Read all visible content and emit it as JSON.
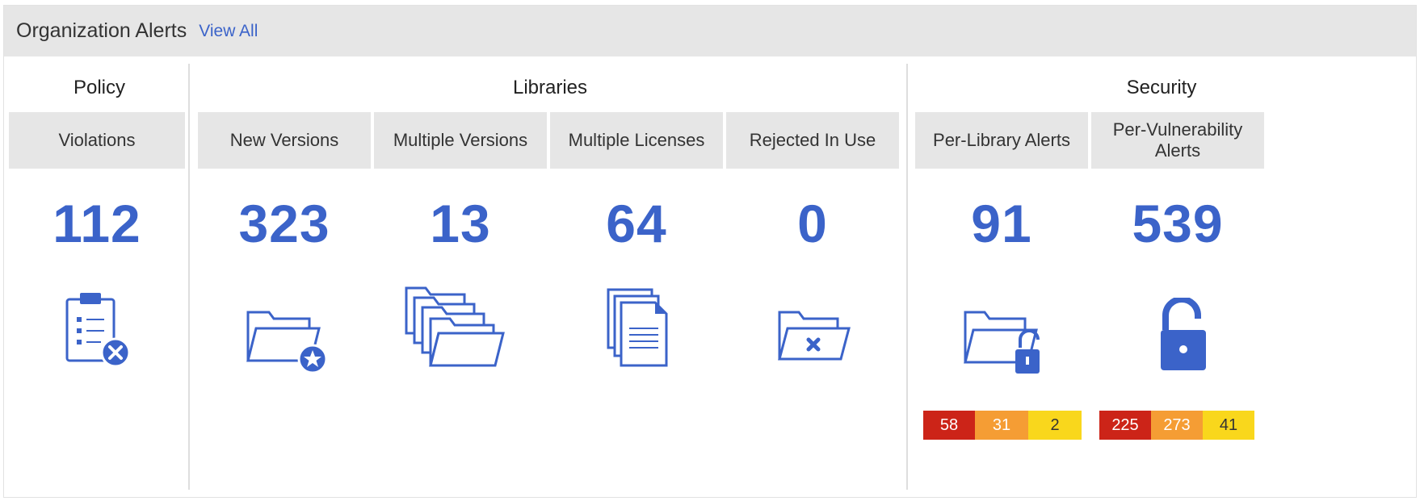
{
  "header": {
    "title": "Organization Alerts",
    "view_all": "View All"
  },
  "groups": {
    "policy": "Policy",
    "libraries": "Libraries",
    "security": "Security"
  },
  "columns": {
    "violations": {
      "label": "Violations",
      "count": "112",
      "icon": "clipboard-x-icon"
    },
    "new_versions": {
      "label": "New Versions",
      "count": "323",
      "icon": "folder-star-icon"
    },
    "multiple_versions": {
      "label": "Multiple Versions",
      "count": "13",
      "icon": "stacked-folders-icon"
    },
    "multiple_licenses": {
      "label": "Multiple Licenses",
      "count": "64",
      "icon": "stacked-documents-icon"
    },
    "rejected_in_use": {
      "label": "Rejected In Use",
      "count": "0",
      "icon": "folder-x-icon"
    },
    "per_library_alerts": {
      "label": "Per-Library Alerts",
      "count": "91",
      "icon": "folder-unlocked-icon",
      "severity": {
        "high": "58",
        "medium": "31",
        "low": "2"
      }
    },
    "per_vulnerability_alerts": {
      "label_line1": "Per-Vulnerability",
      "label_line2": "Alerts",
      "count": "539",
      "icon": "unlocked-padlock-icon",
      "severity": {
        "high": "225",
        "medium": "273",
        "low": "41"
      }
    }
  },
  "colors": {
    "accent": "#3b63c9",
    "header_bg": "#e6e6e6",
    "severity_high": "#cc2418",
    "severity_medium": "#f59d34",
    "severity_low": "#f9d71c"
  }
}
